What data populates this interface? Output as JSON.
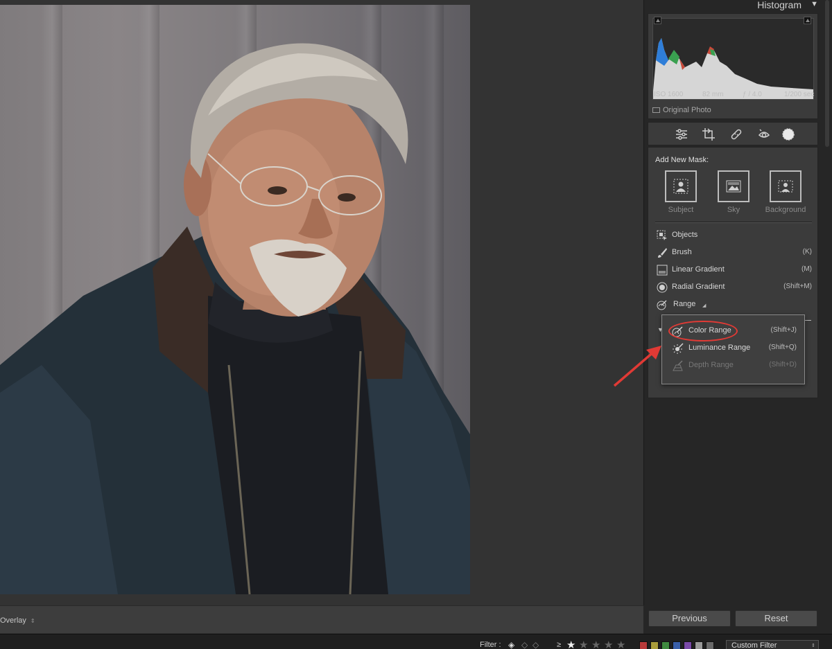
{
  "overlay_menu": {
    "label": "Overlay",
    "arrow": "⇕"
  },
  "filter_bar": {
    "label": "Filter :",
    "gte": "≥",
    "rating_stars": 1,
    "color_swatches": [
      "#b83a3a",
      "#a89c3a",
      "#3f8a3f",
      "#3a5fa8",
      "#7a4aa8",
      "#9a9a9a",
      "#6a6a6a"
    ],
    "custom_filter": "Custom Filter"
  },
  "histogram": {
    "title": "Histogram",
    "iso": "ISO 1600",
    "focal": "82 mm",
    "aperture": "ƒ / 4.0",
    "shutter": "1/200 sec",
    "original_photo": "Original Photo"
  },
  "tools": [
    "edit-icon",
    "crop-icon",
    "heal-icon",
    "redeye-icon",
    "masking-icon"
  ],
  "masking": {
    "header": "Add New Mask:",
    "quick": [
      {
        "label": "Subject",
        "icon": "subject-icon"
      },
      {
        "label": "Sky",
        "icon": "sky-icon"
      },
      {
        "label": "Background",
        "icon": "background-icon"
      }
    ],
    "items": [
      {
        "label": "Objects",
        "shortcut": "",
        "icon": "objects-icon"
      },
      {
        "label": "Brush",
        "shortcut": "(K)",
        "icon": "brush-icon"
      },
      {
        "label": "Linear Gradient",
        "shortcut": "(M)",
        "icon": "linear-gradient-icon"
      },
      {
        "label": "Radial Gradient",
        "shortcut": "(Shift+M)",
        "icon": "radial-gradient-icon"
      },
      {
        "label": "Range",
        "shortcut": "",
        "icon": "range-icon"
      }
    ],
    "range_menu": [
      {
        "label": "Color Range",
        "shortcut": "(Shift+J)",
        "enabled": true
      },
      {
        "label": "Luminance Range",
        "shortcut": "(Shift+Q)",
        "enabled": true
      },
      {
        "label": "Depth Range",
        "shortcut": "(Shift+D)",
        "enabled": false
      }
    ]
  },
  "buttons": {
    "previous": "Previous",
    "reset": "Reset"
  },
  "highlight_color": "#e13a35"
}
